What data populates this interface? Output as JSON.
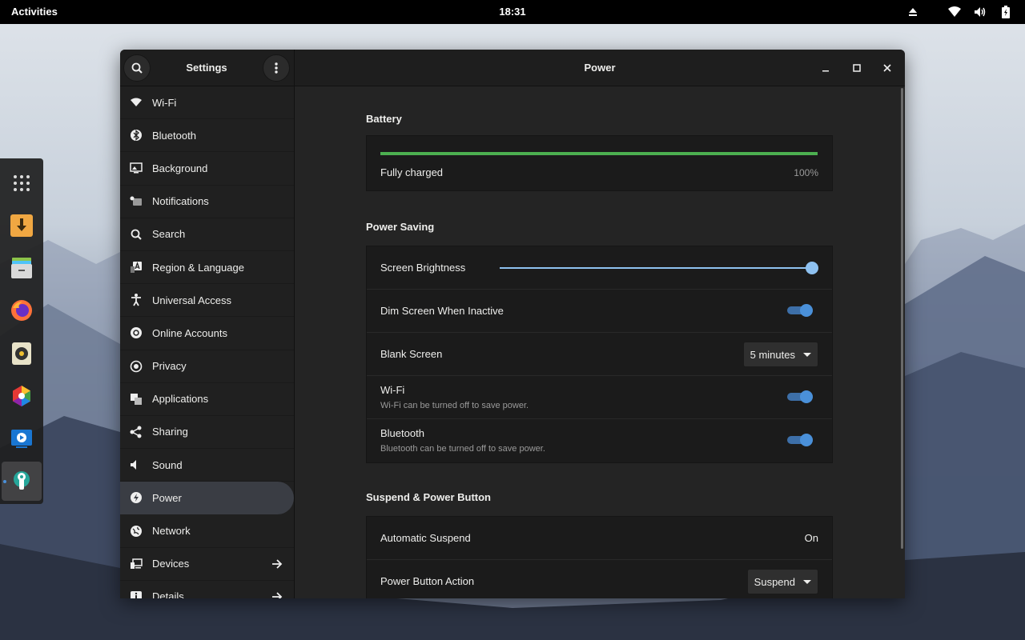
{
  "topbar": {
    "activities": "Activities",
    "clock": "18:31",
    "tray_icons": [
      "eject-icon",
      "wifi-icon",
      "volume-icon",
      "battery-icon"
    ]
  },
  "dock": {
    "items": [
      "app-grid-icon",
      "downloader-icon",
      "files-icon",
      "firefox-icon",
      "rhythmbox-icon",
      "color-picker-icon",
      "video-player-icon",
      "settings-app-icon"
    ]
  },
  "window": {
    "sidebar_title": "Settings",
    "title": "Power"
  },
  "sidebar": {
    "items": [
      {
        "label": "Wi-Fi",
        "icon": "wifi-icon"
      },
      {
        "label": "Bluetooth",
        "icon": "bluetooth-icon"
      },
      {
        "label": "Background",
        "icon": "background-icon"
      },
      {
        "label": "Notifications",
        "icon": "notifications-icon"
      },
      {
        "label": "Search",
        "icon": "search-icon"
      },
      {
        "label": "Region & Language",
        "icon": "region-icon"
      },
      {
        "label": "Universal Access",
        "icon": "accessibility-icon"
      },
      {
        "label": "Online Accounts",
        "icon": "online-accounts-icon"
      },
      {
        "label": "Privacy",
        "icon": "privacy-icon"
      },
      {
        "label": "Applications",
        "icon": "applications-icon"
      },
      {
        "label": "Sharing",
        "icon": "sharing-icon"
      },
      {
        "label": "Sound",
        "icon": "sound-icon"
      },
      {
        "label": "Power",
        "icon": "power-icon"
      },
      {
        "label": "Network",
        "icon": "network-icon"
      },
      {
        "label": "Devices",
        "icon": "devices-icon"
      },
      {
        "label": "Details",
        "icon": "details-icon"
      }
    ]
  },
  "battery": {
    "title": "Battery",
    "status": "Fully charged",
    "percent": "100%",
    "level": 1.0,
    "bar_color": "#4caf50"
  },
  "power_saving": {
    "title": "Power Saving",
    "brightness_label": "Screen Brightness",
    "brightness_level": 1.0,
    "dim_label": "Dim Screen When Inactive",
    "blank_label": "Blank Screen",
    "blank_value": "5 minutes",
    "wifi_label": "Wi-Fi",
    "wifi_sub": "Wi-Fi can be turned off to save power.",
    "bt_label": "Bluetooth",
    "bt_sub": "Bluetooth can be turned off to save power."
  },
  "suspend": {
    "title": "Suspend & Power Button",
    "auto_label": "Automatic Suspend",
    "auto_value": "On",
    "button_label": "Power Button Action",
    "button_value": "Suspend"
  },
  "colors": {
    "accent": "#4a90d9",
    "battery_green": "#4caf50"
  }
}
